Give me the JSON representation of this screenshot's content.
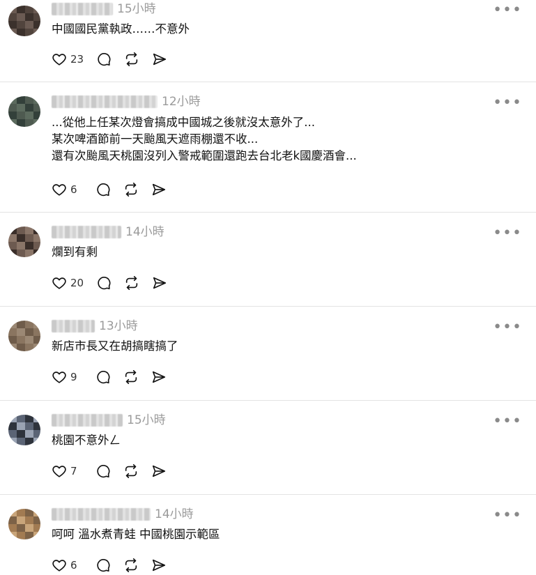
{
  "more_glyph": "•••",
  "posts": [
    {
      "time": "15小時",
      "text": "中國國民黨執政……不意外",
      "likes": "23",
      "avatar_colors": [
        "#6b5b53",
        "#9c8a7e",
        "#3b312c",
        "#c2b1a4",
        "#51443d",
        "#8a7466"
      ]
    },
    {
      "time": "12小時",
      "text": "...從他上任某次燈會搞成中國城之後就沒太意外了...\n某次啤酒節前一天颱風天遮雨棚還不收...\n還有次颱風天桃園沒列入警戒範圍還跑去台北老k國慶酒會...",
      "likes": "6",
      "avatar_colors": [
        "#5c6b5e",
        "#8b978a",
        "#33403a",
        "#a9b5a8",
        "#4e5a50",
        "#b06e5e"
      ]
    },
    {
      "time": "14小時",
      "text": "爛到有剩",
      "likes": "20",
      "avatar_colors": [
        "#3a2e29",
        "#1c1614",
        "#6d5a50",
        "#2a2420",
        "#8a7568",
        "#120e0c"
      ]
    },
    {
      "time": "13小時",
      "text": "新店市長又在胡搞瞎搞了",
      "likes": "9",
      "avatar_colors": [
        "#9b8874",
        "#d2c1ad",
        "#6f5c4a",
        "#bca58c",
        "#8a7560",
        "#e0d2c0"
      ]
    },
    {
      "time": "15小時",
      "text": "桃園不意外ㄥ",
      "likes": "7",
      "avatar_colors": [
        "#9aa3b3",
        "#d9dde4",
        "#5b6475",
        "#eceff3",
        "#2e333c",
        "#b8c0cc"
      ]
    },
    {
      "time": "14小時",
      "text": "呵呵 溫水煮青蛙 中國桃園示範區",
      "likes": "6",
      "avatar_colors": [
        "#c9a57a",
        "#e8d3b4",
        "#a27b52",
        "#f0e2cc",
        "#7d6247",
        "#d9bb92"
      ]
    }
  ]
}
